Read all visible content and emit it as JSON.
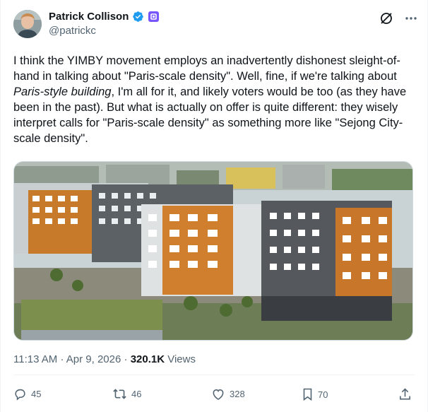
{
  "author": {
    "display_name": "Patrick Collison",
    "handle": "@patrickc",
    "verified": true,
    "accent_color": "#1d9bf0",
    "affiliate_badge_color": "#7856ff"
  },
  "header_icons": [
    "grok-icon",
    "more-icon"
  ],
  "post": {
    "text_part1": "I think the YIMBY movement employs an inadvertently dishonest sleight-of-hand in talking about \"Paris-scale density\". Well, fine, if we're talking about ",
    "text_italic": "Paris-style building",
    "text_part2": ", I'm all for it, and likely voters would be too (as they have been in the past). But what is actually on offer is quite different: they wisely interpret calls for \"Paris-scale density\" as something more like \"Sejong City-scale density\"."
  },
  "meta": {
    "time": "11:13 AM",
    "separator": "·",
    "date": "Apr 9, 2026",
    "views_count": "320.1K",
    "views_label": "Views"
  },
  "actions": {
    "replies": "45",
    "reposts": "46",
    "likes": "328",
    "bookmarks": "70"
  }
}
